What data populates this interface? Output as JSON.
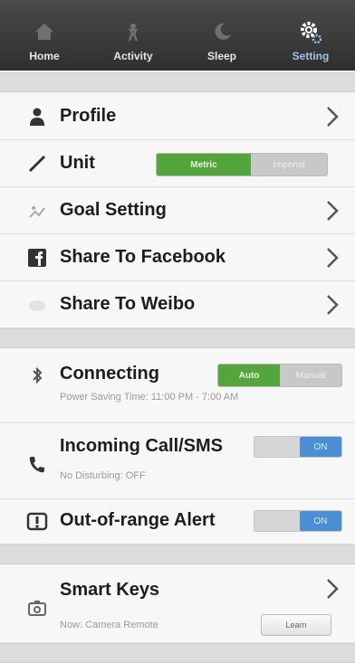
{
  "tabs": [
    {
      "label": "Home",
      "icon": "home-icon",
      "active": false
    },
    {
      "label": "Activity",
      "icon": "activity-icon",
      "active": false
    },
    {
      "label": "Sleep",
      "icon": "sleep-icon",
      "active": false
    },
    {
      "label": "Setting",
      "icon": "gear-icon",
      "active": true
    }
  ],
  "rows": {
    "profile": {
      "label": "Profile"
    },
    "unit": {
      "label": "Unit",
      "toggle_on": "Metric",
      "toggle_off": "Imperial"
    },
    "goal": {
      "label": "Goal Setting"
    },
    "facebook": {
      "label": "Share To Facebook"
    },
    "weibo": {
      "label": "Share To Weibo"
    },
    "connecting": {
      "label": "Connecting",
      "sub": "Power Saving Time: 11:00 PM - 7:00 AM",
      "toggle_on": "Auto",
      "toggle_off": "Manual"
    },
    "incoming": {
      "label": "Incoming Call/SMS",
      "sub": "No Disturbing: OFF",
      "switch": "ON"
    },
    "alert": {
      "label": "Out-of-range Alert",
      "switch": "ON"
    },
    "smartkeys": {
      "label": "Smart Keys",
      "sub": "Now: Camera Remote",
      "button": "Learn"
    }
  },
  "colors": {
    "accent_green": "#54a63c",
    "accent_blue": "#4a8fd6",
    "topbar": "#3a3a3a"
  }
}
